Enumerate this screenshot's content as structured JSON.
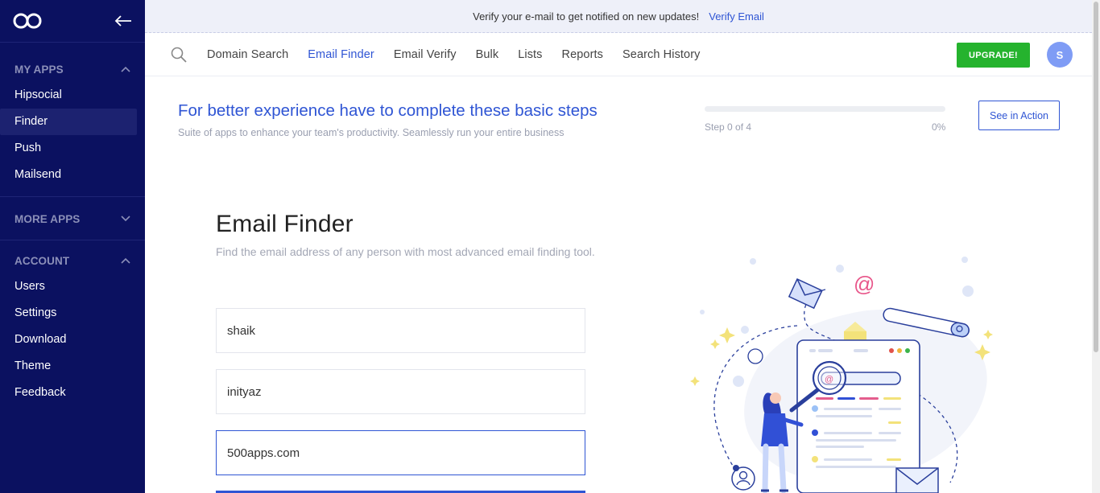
{
  "sidebar": {
    "my_apps_label": "MY APPS",
    "my_apps": [
      {
        "label": "Hipsocial"
      },
      {
        "label": "Finder"
      },
      {
        "label": "Push"
      },
      {
        "label": "Mailsend"
      }
    ],
    "more_apps_label": "MORE APPS",
    "account_label": "ACCOUNT",
    "account_items": [
      {
        "label": "Users"
      },
      {
        "label": "Settings"
      },
      {
        "label": "Download"
      },
      {
        "label": "Theme"
      },
      {
        "label": "Feedback"
      }
    ],
    "active_item": "Finder"
  },
  "banner": {
    "text": "Verify your e-mail to get notified on new updates!",
    "link": "Verify Email"
  },
  "topnav": {
    "tabs": [
      {
        "label": "Domain Search"
      },
      {
        "label": "Email Finder"
      },
      {
        "label": "Email Verify"
      },
      {
        "label": "Bulk"
      },
      {
        "label": "Lists"
      },
      {
        "label": "Reports"
      },
      {
        "label": "Search History"
      }
    ],
    "active_tab": "Email Finder",
    "upgrade_label": "UPGRADE!",
    "avatar_initial": "S"
  },
  "steps": {
    "title": "For better experience have to complete these basic steps",
    "subtitle": "Suite of apps to enhance your team's productivity. Seamlessly run your entire business",
    "progress_text": "Step 0 of 4",
    "progress_percent": "0%",
    "progress_value": 0,
    "see_action_label": "See in Action"
  },
  "finder": {
    "title": "Email Finder",
    "subtitle": "Find the email address of any person with most advanced email finding tool.",
    "first_name": "shaik",
    "last_name": "inityaz",
    "domain": "500apps.com"
  },
  "colors": {
    "sidebar_bg": "#0b1160",
    "accent": "#2f55d4",
    "upgrade": "#25b32e",
    "avatar": "#7f9cf5"
  }
}
